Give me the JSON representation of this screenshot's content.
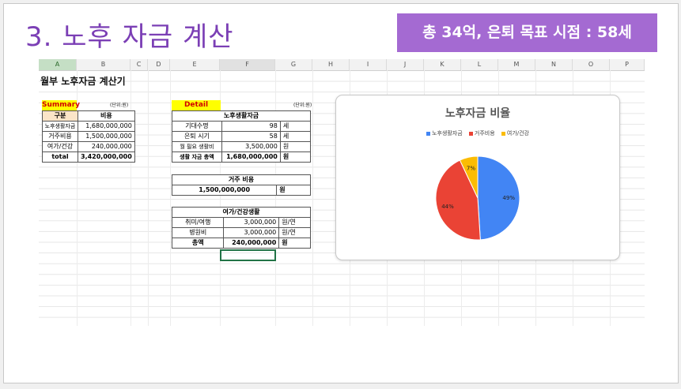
{
  "slide": {
    "title": "3. 노후 자금 계산",
    "banner": "총 34억, 은퇴 목표 시점  : 58세"
  },
  "sheet": {
    "columns": [
      "A",
      "B",
      "C",
      "D",
      "E",
      "F",
      "G",
      "H",
      "I",
      "J",
      "K",
      "L",
      "M",
      "N",
      "O",
      "P"
    ],
    "heading": "월부 노후자금 계산기",
    "summary": {
      "label": "Summary",
      "unit": "(단위:원)",
      "header": [
        "구분",
        "비용"
      ],
      "rows": [
        [
          "노후생활자금",
          "1,680,000,000"
        ],
        [
          "거주비용",
          "1,500,000,000"
        ],
        [
          "여가/건강",
          "240,000,000"
        ]
      ],
      "total": [
        "total",
        "3,420,000,000"
      ]
    },
    "detail": {
      "label": "Detail",
      "unit": "(단위:원)",
      "living": {
        "title": "노후생활자금",
        "rows": [
          [
            "기대수명",
            "98",
            "세"
          ],
          [
            "은퇴 시기",
            "58",
            "세"
          ],
          [
            "월 필요 생활비",
            "3,500,000",
            "원"
          ],
          [
            "생활 자금 총액",
            "1,680,000,000",
            "원"
          ]
        ]
      },
      "housing": {
        "title": "거주 비용",
        "value": "1,500,000,000",
        "unit": "원"
      },
      "leisure": {
        "title": "여가/건강생활",
        "rows": [
          [
            "취미/여행",
            "3,000,000",
            "원/연"
          ],
          [
            "병원비",
            "3,000,000",
            "원/연"
          ],
          [
            "총액",
            "240,000,000",
            "원"
          ]
        ]
      }
    }
  },
  "chart_data": {
    "type": "pie",
    "title": "노후자금 비율",
    "categories": [
      "노후생활자금",
      "거주비용",
      "여가/건강"
    ],
    "values": [
      49,
      44,
      7
    ],
    "labels": [
      "49%",
      "44%",
      "7%"
    ],
    "colors": [
      "#4285f4",
      "#ea4335",
      "#fbbc04"
    ],
    "legend": "top"
  }
}
